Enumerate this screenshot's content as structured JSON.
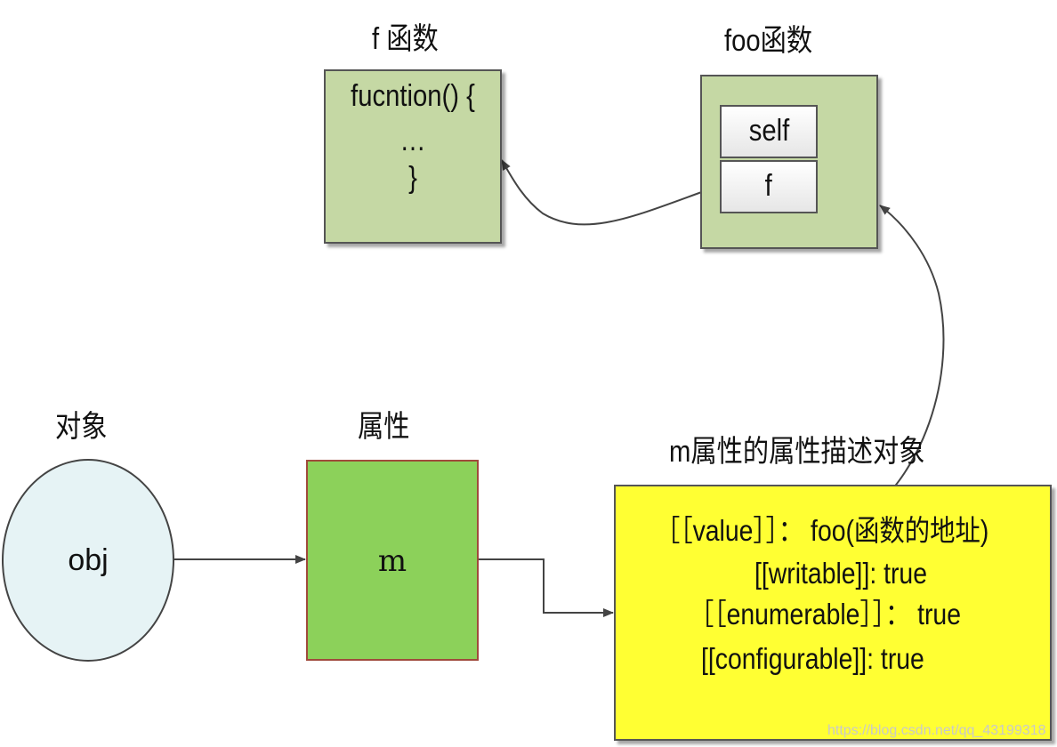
{
  "f_function": {
    "title": "f 函数",
    "code": [
      "fucntion() {",
      "…",
      "}"
    ]
  },
  "foo_function": {
    "title": "foo函数",
    "slots": [
      "self",
      "f"
    ]
  },
  "object": {
    "title": "对象",
    "label": "obj"
  },
  "property": {
    "title": "属性",
    "label": "m"
  },
  "descriptor": {
    "title": "m属性的属性描述对象",
    "lines": [
      "［［value］］： foo(函数的地址)",
      "[[writable]]: true",
      "［［enumerable］］：  true",
      "[[configurable]]:  true"
    ]
  },
  "watermark": "https://blog.csdn.net/qq_43199318",
  "colors": {
    "function_box": "#c5d8a4",
    "object_fill": "#e6f3f5",
    "property_fill": "#8cd15a",
    "descriptor_fill": "#ffff33"
  }
}
